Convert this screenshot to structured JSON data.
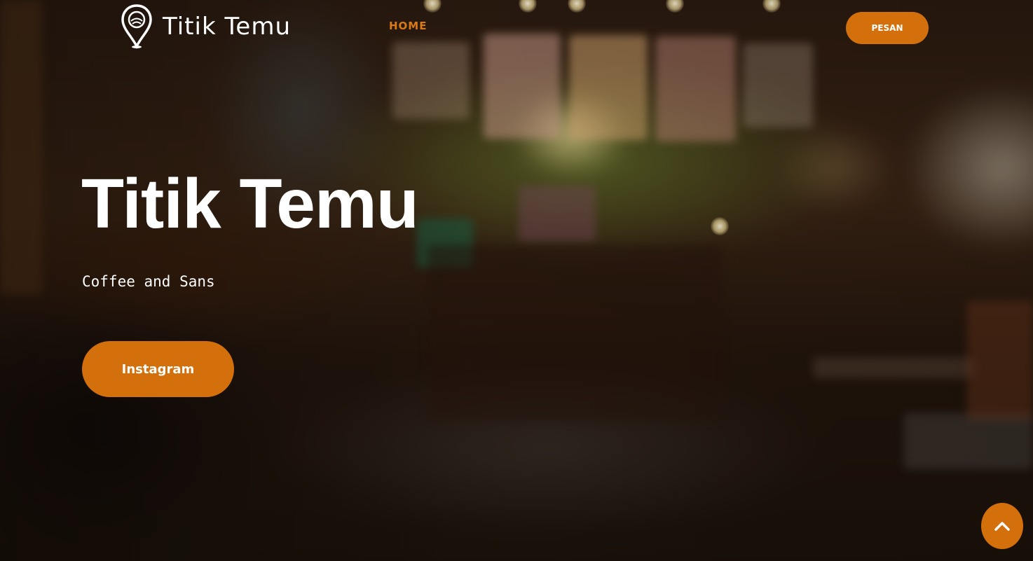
{
  "header": {
    "logo_text": "Titik Temu",
    "nav": {
      "home_label": "HOME"
    },
    "cta_label": "PESAN"
  },
  "hero": {
    "title": "Titik Temu",
    "subtitle": "Coffee and Sans",
    "button_label": "Instagram"
  },
  "icons": {
    "logo": "map-pin-logo-icon",
    "back_to_top": "chevron-up-icon"
  },
  "colors": {
    "accent": "#d3700b",
    "nav_active": "#d97a14",
    "text": "#ffffff"
  }
}
